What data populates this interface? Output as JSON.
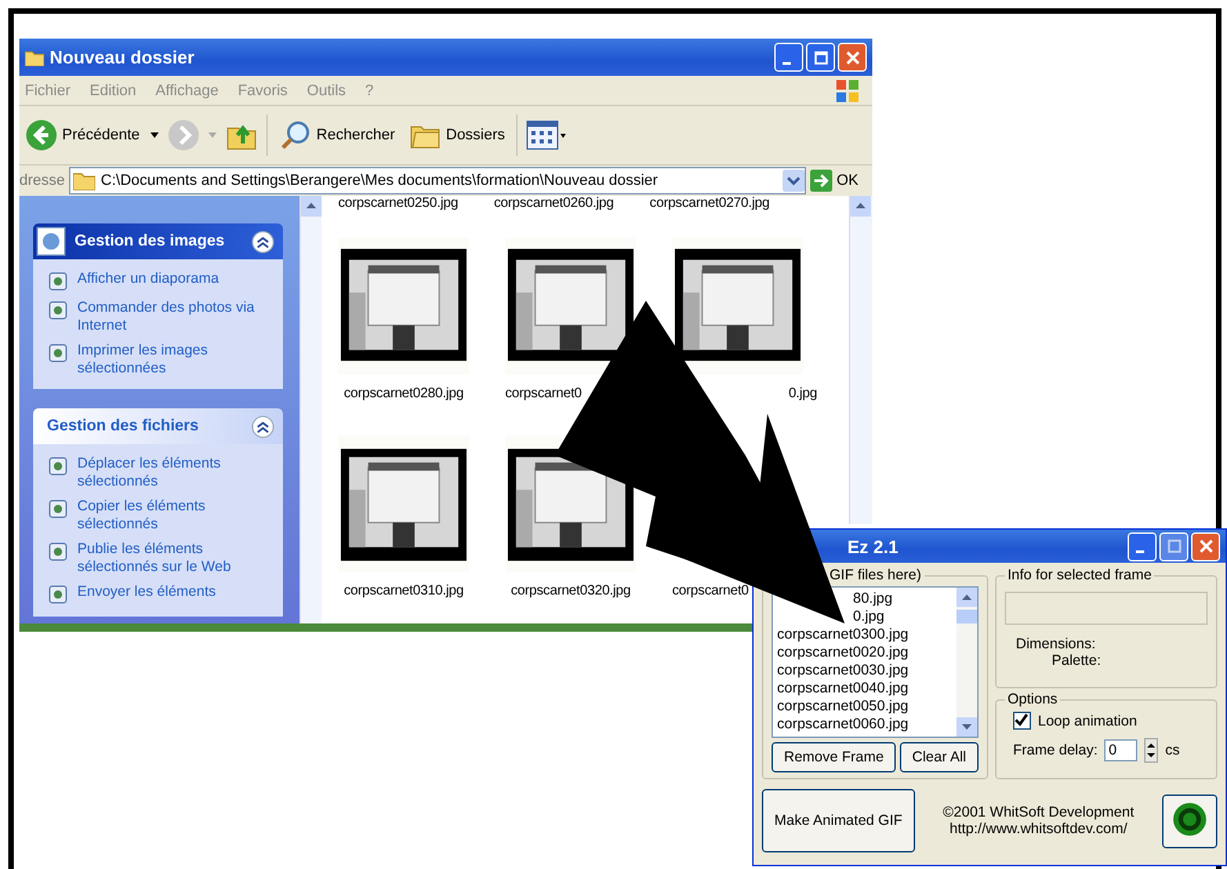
{
  "explorer": {
    "title": "Nouveau dossier",
    "menu": [
      "Fichier",
      "Edition",
      "Affichage",
      "Favoris",
      "Outils",
      "?"
    ],
    "toolbar": {
      "back": "Précédente",
      "search": "Rechercher",
      "folders": "Dossiers"
    },
    "address": {
      "label": "dresse",
      "value": "C:\\Documents and Settings\\Berangere\\Mes documents\\formation\\Nouveau dossier",
      "go": "OK"
    },
    "panels": [
      {
        "title": "Gestion des images",
        "kind": "primary",
        "expanded": true,
        "items": [
          "Afficher un diaporama",
          "Commander des photos via Internet",
          "Imprimer les images sélectionnées"
        ]
      },
      {
        "title": "Gestion des fichiers",
        "kind": "normal",
        "expanded": true,
        "items": [
          "Déplacer les éléments sélectionnés",
          "Copier les éléments sélectionnés",
          "Publie les éléments sélectionnés sur le Web",
          "Envoyer les éléments"
        ]
      }
    ],
    "top_labels": [
      "corpscarnet0250.jpg",
      "corpscarnet0260.jpg",
      "corpscarnet0270.jpg"
    ],
    "files": [
      {
        "label": "corpscarnet0280.jpg",
        "thumb": true
      },
      {
        "label": "corpscarnet0",
        "thumb": true
      },
      {
        "label": "0.jpg",
        "thumb": true
      },
      {
        "label": "corpscarnet0310.jpg",
        "thumb": true
      },
      {
        "label": "corpscarnet0320.jpg",
        "thumb": true
      },
      {
        "label": "corpscarnet0",
        "thumb": false
      }
    ]
  },
  "gif_window": {
    "title": "Ez 2.1",
    "frames_group": "GIF files here)",
    "frames": [
      {
        "name": "80.jpg",
        "covered": true
      },
      {
        "name": "0.jpg",
        "covered": true
      },
      {
        "name": "corpscarnet0300.jpg",
        "covered": false
      },
      {
        "name": "corpscarnet0020.jpg",
        "covered": false
      },
      {
        "name": "corpscarnet0030.jpg",
        "covered": false
      },
      {
        "name": "corpscarnet0040.jpg",
        "covered": false
      },
      {
        "name": "corpscarnet0050.jpg",
        "covered": false
      },
      {
        "name": "corpscarnet0060.jpg",
        "covered": false
      }
    ],
    "remove": "Remove Frame",
    "clear": "Clear All",
    "info_group": "Info for selected frame",
    "dimensions": "Dimensions:",
    "palette": "Palette:",
    "options_group": "Options",
    "loop": {
      "label": "Loop animation",
      "checked": true
    },
    "delay": {
      "label": "Frame delay:",
      "value": "0",
      "unit": "cs"
    },
    "make": "Make Animated GIF",
    "copyright": "©2001 WhitSoft Development",
    "url": "http://www.whitsoftdev.com/"
  }
}
